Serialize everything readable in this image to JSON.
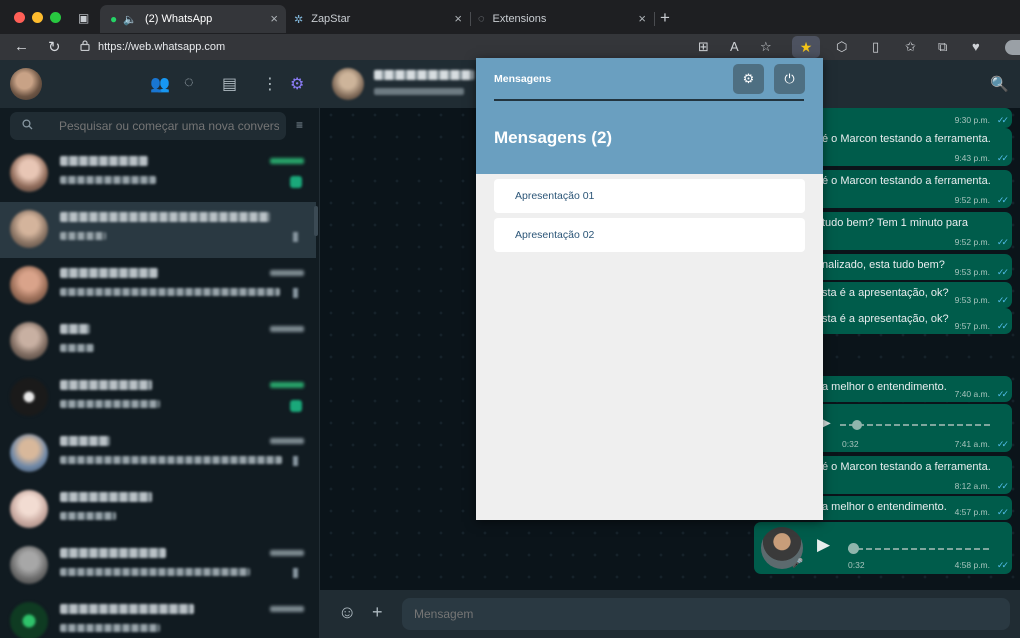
{
  "browser": {
    "tabs": [
      {
        "label": "(2) WhatsApp",
        "close": "×"
      },
      {
        "label": "ZapStar",
        "close": "×"
      },
      {
        "label": "Extensions",
        "close": "×"
      }
    ],
    "new_tab": "+",
    "url": "https://web.whatsapp.com",
    "icons": {
      "back": "←",
      "reload": "↻",
      "lock": "🔒",
      "tab_grid": "⊞",
      "read_aloud": "A",
      "favorite": "☆",
      "favorite_active": "★",
      "extensions": "⬡",
      "split": "▯",
      "collections": "✩",
      "tabs": "⧉",
      "health": "♥"
    },
    "colors": {
      "close_red": "#ff5f57",
      "min_yellow": "#febc2e",
      "max_green": "#28c840"
    }
  },
  "sidebar": {
    "icons": {
      "community": "👥",
      "status": "◌",
      "channels": "▤",
      "menu": "⋮",
      "settings": "⚙"
    },
    "search": {
      "placeholder": "Pesquisar ou começar uma nova conversa",
      "icon": "🔍",
      "filter_icon": "≡"
    }
  },
  "conversation": {
    "search_icon": "🔍",
    "messages": [
      {
        "text": "",
        "time": "9:30 p.m.",
        "ticks": "✓✓"
      },
      {
        "text": "é o Marcon testando a ferramenta.",
        "time": "9:43 p.m.",
        "ticks": "✓✓"
      },
      {
        "text": "é o Marcon testando a ferramenta.",
        "time": "9:52 p.m.",
        "ticks": "✓✓"
      },
      {
        "text": "tudo bem? Tem 1 minuto para",
        "time": "9:52 p.m.",
        "ticks": "✓✓"
      },
      {
        "text": "nalizado, esta tudo bem?",
        "time": "9:53 p.m.",
        "ticks": "✓✓"
      },
      {
        "text": "sta é a apresentação, ok?",
        "time": "9:53 p.m.",
        "ticks": "✓✓"
      },
      {
        "text": "sta é a apresentação, ok?",
        "time": "9:57 p.m.",
        "ticks": "✓✓"
      },
      {
        "text": "a melhor o entendimento.",
        "time": "7:40 a.m.",
        "ticks": "✓✓"
      },
      {
        "text": "é o Marcon testando a ferramenta.",
        "time": "8:12 a.m.",
        "ticks": "✓✓"
      },
      {
        "text": "a melhor o entendimento.",
        "time": "4:57 p.m.",
        "ticks": "✓✓"
      }
    ],
    "audio_msg": {
      "duration": "0:32",
      "time": "7:41 a.m.",
      "ticks": "✓✓",
      "play": "▶"
    },
    "last_audio": {
      "duration": "0:32",
      "time": "4:58 p.m.",
      "ticks": "✓✓",
      "play": "▶",
      "mic": "🎤"
    },
    "composer": {
      "placeholder": "Mensagem",
      "emoji_icon": "☺",
      "attach_icon": "+"
    }
  },
  "popup": {
    "header_label": "Mensagens",
    "title": "Mensagens (2)",
    "settings_icon": "⚙",
    "power_icon": "⏻",
    "items": [
      {
        "label": "Apresentação 01"
      },
      {
        "label": "Apresentação 02"
      }
    ],
    "colors": {
      "header": "#6a9fc0",
      "button": "#4e6f82",
      "item_text": "#2b5577"
    }
  }
}
